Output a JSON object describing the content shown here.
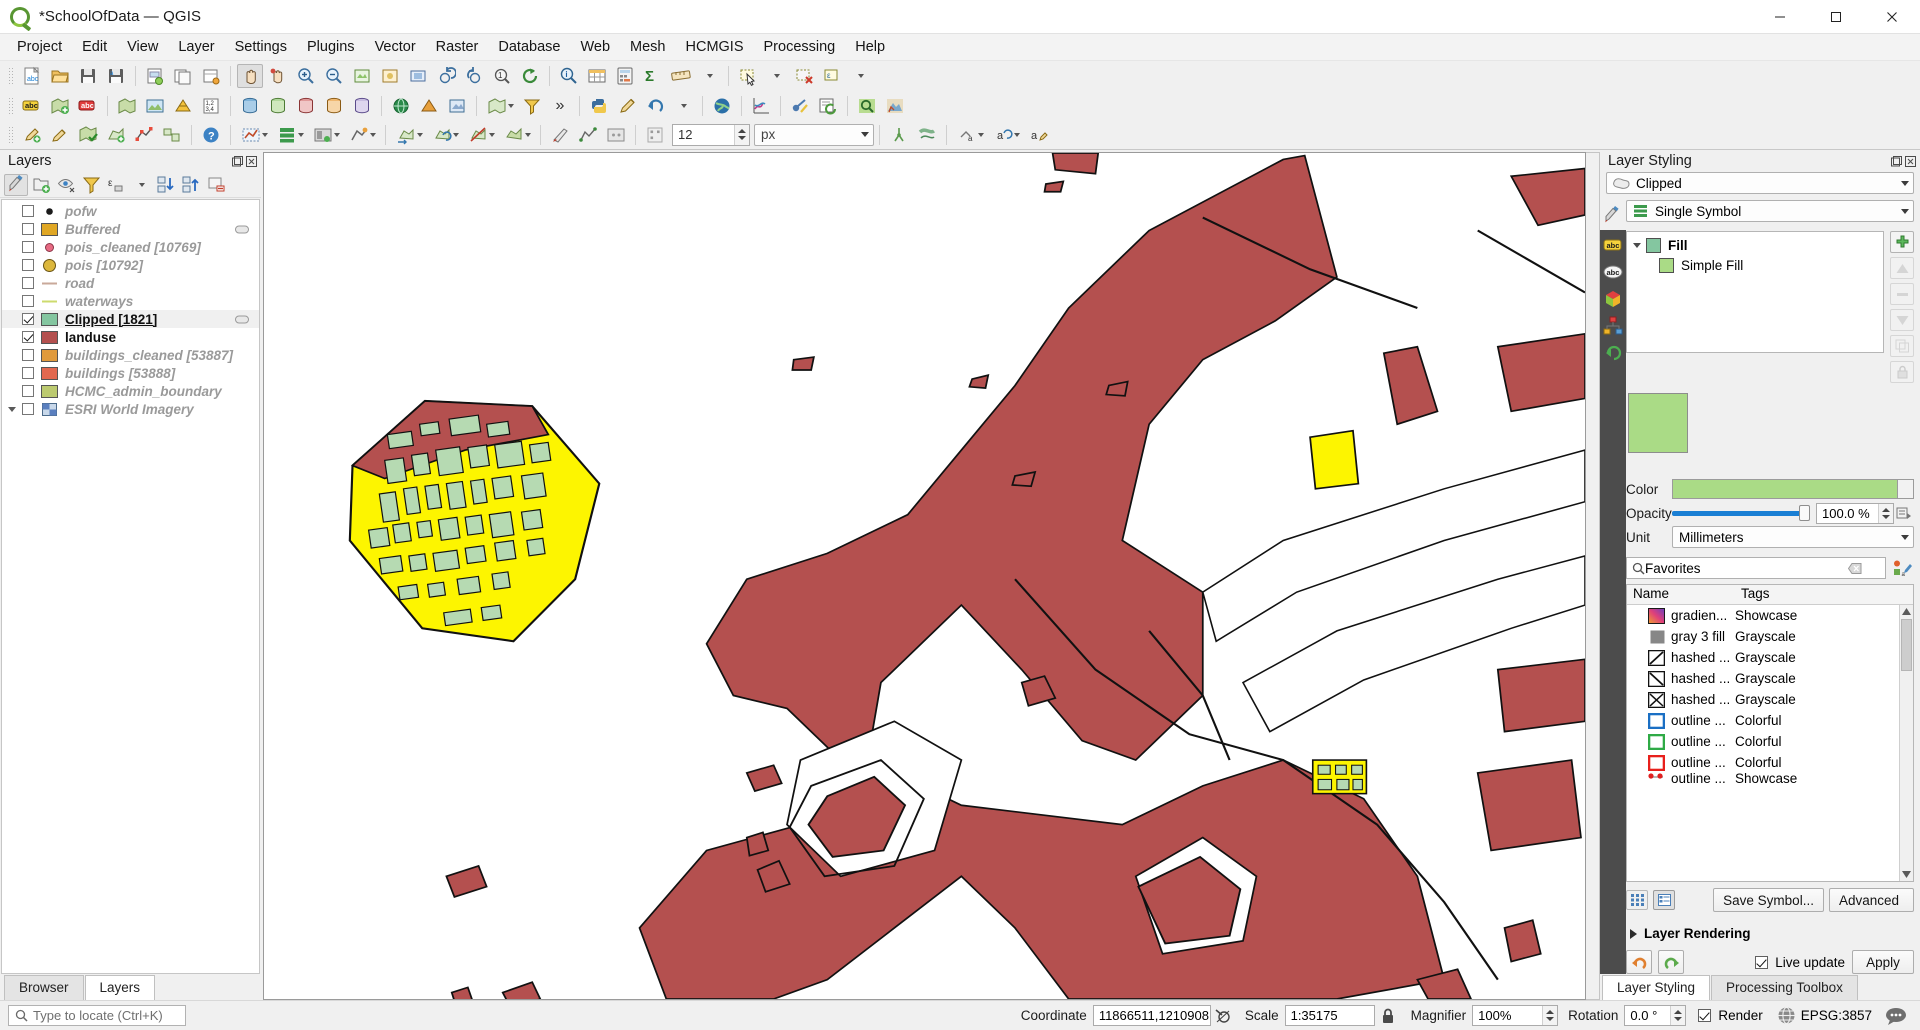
{
  "window": {
    "title": "*SchoolOfData — QGIS",
    "logo_icon": "qgis-logo-icon",
    "minimize_icon": "minimize-icon",
    "maximize_icon": "maximize-icon",
    "close_icon": "close-icon"
  },
  "menubar": {
    "items": [
      {
        "label": "Project"
      },
      {
        "label": "Edit"
      },
      {
        "label": "View"
      },
      {
        "label": "Layer"
      },
      {
        "label": "Settings"
      },
      {
        "label": "Plugins"
      },
      {
        "label": "Vector"
      },
      {
        "label": "Raster"
      },
      {
        "label": "Database"
      },
      {
        "label": "Web"
      },
      {
        "label": "Mesh"
      },
      {
        "label": "HCMGIS"
      },
      {
        "label": "Processing"
      },
      {
        "label": "Help"
      }
    ]
  },
  "layers_panel": {
    "title": "Layers",
    "dock_icon": "undock-icon",
    "close_icon": "close-icon",
    "toolbar": [
      {
        "name": "open-layer-styling-panel",
        "icon": "paintbrush-icon"
      },
      {
        "name": "add-group",
        "icon": "add-group-icon"
      },
      {
        "name": "manage-map-themes",
        "icon": "eye-icon"
      },
      {
        "name": "filter-legend-by-map-content",
        "icon": "filter-icon"
      },
      {
        "name": "filter-legend-by-expression",
        "icon": "expression-filter-icon"
      },
      {
        "name": "filter-legend-dropdown",
        "icon": "chevron-down-icon"
      },
      {
        "name": "expand-all",
        "icon": "expand-all-icon"
      },
      {
        "name": "collapse-all",
        "icon": "collapse-all-icon"
      },
      {
        "name": "remove-layer-group",
        "icon": "remove-layer-icon"
      }
    ],
    "items": [
      {
        "label": "pofw",
        "checked": false,
        "symbol": "point-black",
        "color": "#1b1b1b",
        "indicator": false
      },
      {
        "label": "Buffered",
        "checked": false,
        "symbol": "fill",
        "color": "#e0a724",
        "indicator": false
      },
      {
        "label": "pois_cleaned [10769]",
        "checked": false,
        "symbol": "point-pink",
        "color": "#e76a83",
        "indicator": false
      },
      {
        "label": "pois [10792]",
        "checked": false,
        "symbol": "point-big-yellow",
        "color": "#dcb73c",
        "indicator": false
      },
      {
        "label": "road",
        "checked": false,
        "symbol": "line",
        "color": "#c9a99a",
        "indicator": false
      },
      {
        "label": "waterways",
        "checked": false,
        "symbol": "line",
        "color": "#cddb6e",
        "indicator": false
      },
      {
        "label": "Clipped [1821]",
        "checked": true,
        "symbol": "fill",
        "color": "#84c6a0",
        "indicator": true,
        "current": true
      },
      {
        "label": "landuse",
        "checked": true,
        "symbol": "fill",
        "color": "#b4504f",
        "indicator": false
      },
      {
        "label": "buildings_cleaned [53887]",
        "checked": false,
        "symbol": "fill",
        "color": "#e09a3c",
        "indicator": false
      },
      {
        "label": "buildings [53888]",
        "checked": false,
        "symbol": "fill",
        "color": "#e2684f",
        "indicator": false
      },
      {
        "label": "HCMC_admin_boundary",
        "checked": false,
        "symbol": "fill",
        "color": "#bcca70",
        "indicator": false
      },
      {
        "label": "ESRI World Imagery",
        "checked": false,
        "symbol": "raster",
        "color": "#5a7fbf",
        "indicator": false,
        "group": true
      }
    ],
    "tabs": [
      {
        "label": "Browser",
        "active": false
      },
      {
        "label": "Layers",
        "active": true
      }
    ]
  },
  "styling_panel": {
    "title": "Layer Styling",
    "dock_icon": "undock-icon",
    "close_icon": "close-icon",
    "layer_selector": {
      "value": "Clipped",
      "icon": "polygon-layer-icon"
    },
    "renderer_selector": {
      "value": "Single Symbol",
      "icon": "single-symbol-icon"
    },
    "side_tabs": [
      {
        "name": "symbology-tab",
        "icon": "paintbrush-icon"
      },
      {
        "name": "labels-tab",
        "icon": "labels-abc-icon"
      },
      {
        "name": "masks-tab",
        "icon": "abc-mask-icon"
      },
      {
        "name": "3d-view-tab",
        "icon": "cube-3d-icon"
      },
      {
        "name": "diagrams-tab",
        "icon": "diagram-icon"
      },
      {
        "name": "history-tab",
        "icon": "history-undo-icon"
      }
    ],
    "symbol_tree": [
      {
        "label": "Fill",
        "level": 0,
        "color": "#84c6a0"
      },
      {
        "label": "Simple Fill",
        "level": 1,
        "color": "#aadb86"
      }
    ],
    "tree_buttons": [
      {
        "name": "add-symbol-layer",
        "icon": "plus-green-icon",
        "enabled": true
      },
      {
        "name": "move-symbol-up",
        "icon": "arrow-up-icon",
        "enabled": false
      },
      {
        "name": "remove-symbol-layer",
        "icon": "minus-icon",
        "enabled": false
      },
      {
        "name": "move-symbol-down",
        "icon": "arrow-down-icon",
        "enabled": false
      },
      {
        "name": "duplicate-symbol-layer",
        "icon": "copy-icon",
        "enabled": false
      },
      {
        "name": "lock-symbol-layer",
        "icon": "lock-icon",
        "enabled": false
      }
    ],
    "preview_color": "#aadb86",
    "fields": {
      "color_label": "Color",
      "color_value": "#aadb86",
      "opacity_label": "Opacity",
      "opacity_value": "100.0 %",
      "unit_label": "Unit",
      "unit_value": "Millimeters"
    },
    "symbol_search": {
      "value": "Favorites",
      "search_icon": "search-icon",
      "clear_icon": "clear-icon",
      "dropdown_icon": "chevron-down-icon",
      "style_manager_icon": "style-manager-icon"
    },
    "symbol_table": {
      "columns": [
        "Name",
        "Tags"
      ],
      "rows": [
        {
          "name": "gradien...",
          "tags": "Showcase",
          "icon": "gradient-swatch"
        },
        {
          "name": "gray 3 fill",
          "tags": "Grayscale",
          "icon": "gray-swatch"
        },
        {
          "name": "hashed ...",
          "tags": "Grayscale",
          "icon": "hashed-fwd-swatch"
        },
        {
          "name": "hashed ...",
          "tags": "Grayscale",
          "icon": "hashed-back-swatch"
        },
        {
          "name": "hashed ...",
          "tags": "Grayscale",
          "icon": "hashed-cross-swatch"
        },
        {
          "name": "outline ...",
          "tags": "Colorful",
          "icon": "outline-blue-swatch"
        },
        {
          "name": "outline ...",
          "tags": "Colorful",
          "icon": "outline-green-swatch"
        },
        {
          "name": "outline ...",
          "tags": "Colorful",
          "icon": "outline-red-swatch"
        },
        {
          "name": "outline ...",
          "tags": "Showcase",
          "icon": "outline-marker-swatch"
        }
      ]
    },
    "view_buttons": [
      {
        "name": "icon-view-button",
        "icon": "grid-view-icon"
      },
      {
        "name": "list-view-button",
        "icon": "list-view-icon",
        "active": true
      }
    ],
    "save_symbol_label": "Save Symbol...",
    "advanced_label": "Advanced",
    "layer_rendering_label": "Layer Rendering",
    "undo_icon": "undo-arrow-icon",
    "redo_icon": "redo-arrow-icon",
    "live_update_label": "Live update",
    "live_update_checked": true,
    "apply_label": "Apply",
    "tabs": [
      {
        "label": "Layer Styling",
        "active": true
      },
      {
        "label": "Processing Toolbox",
        "active": false
      }
    ]
  },
  "statusbar": {
    "locate_placeholder": "Type to locate (Ctrl+K)",
    "search_icon": "search-icon",
    "coordinate_label": "Coordinate",
    "coordinate_value": "11866511,1210908",
    "toggle_extents_icon": "extents-toggle-icon",
    "scale_label": "Scale",
    "scale_value": "1:35175",
    "lock_icon": "lock-scale-icon",
    "magnifier_label": "Magnifier",
    "magnifier_value": "100%",
    "rotation_label": "Rotation",
    "rotation_value": "0.0 °",
    "render_label": "Render",
    "render_checked": true,
    "crs_label": "EPSG:3857",
    "crs_icon": "globe-icon",
    "messages_icon": "message-bubble-icon"
  },
  "toolbar2": {
    "size_value": "12",
    "unit_value": "px"
  },
  "map": {
    "landuse_color": "#b4504f",
    "clipped_color": "#fdf500",
    "building_color": "#b6dab2",
    "outline_color": "#111111",
    "background": "#ffffff"
  }
}
